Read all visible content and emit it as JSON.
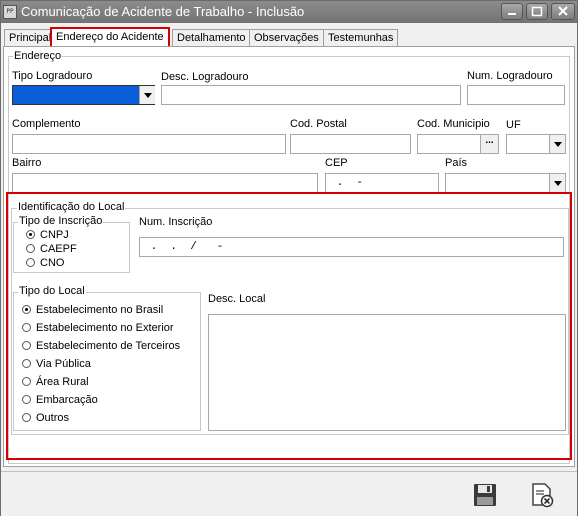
{
  "window": {
    "app_icon": "PP",
    "title": "Comunicação de Acidente de Trabalho - Inclusão"
  },
  "tabs": [
    "Principal",
    "Endereço do Acidente",
    "Detalhamento",
    "Observações",
    "Testemunhas"
  ],
  "endereco": {
    "legend": "Endereço",
    "tipo_logradouro": {
      "label": "Tipo Logradouro",
      "value": ""
    },
    "desc_logradouro": {
      "label": "Desc. Logradouro",
      "value": ""
    },
    "num_logradouro": {
      "label": "Num. Logradouro",
      "value": ""
    },
    "complemento": {
      "label": "Complemento",
      "value": ""
    },
    "cod_postal": {
      "label": "Cod. Postal",
      "value": ""
    },
    "cod_municipio": {
      "label": "Cod. Municipio",
      "value": "",
      "button": "..."
    },
    "uf": {
      "label": "UF",
      "value": ""
    },
    "bairro": {
      "label": "Bairro",
      "value": ""
    },
    "cep": {
      "label": "CEP",
      "value": " .  -"
    },
    "pais": {
      "label": "País",
      "value": ""
    }
  },
  "identificacao": {
    "legend": "Identificação do Local",
    "tipo_inscricao": {
      "legend": "Tipo de Inscrição",
      "options": [
        "CNPJ",
        "CAEPF",
        "CNO"
      ],
      "selected": "CNPJ"
    },
    "num_inscricao": {
      "label": "Num. Inscrição",
      "value": " .  .  /   -"
    },
    "tipo_local": {
      "legend": "Tipo do Local",
      "options": [
        "Estabelecimento no Brasil",
        "Estabelecimento no Exterior",
        "Estabelecimento de Terceiros",
        "Via Pública",
        "Área Rural",
        "Embarcação",
        "Outros"
      ],
      "selected": "Estabelecimento no Brasil"
    },
    "desc_local": {
      "label": "Desc. Local",
      "value": ""
    }
  },
  "toolbar": {
    "save_icon": "floppy-disk-icon",
    "cancel_icon": "cancel-document-icon"
  },
  "colors": {
    "highlight": "#d40000",
    "selection": "#0a5fd8"
  }
}
